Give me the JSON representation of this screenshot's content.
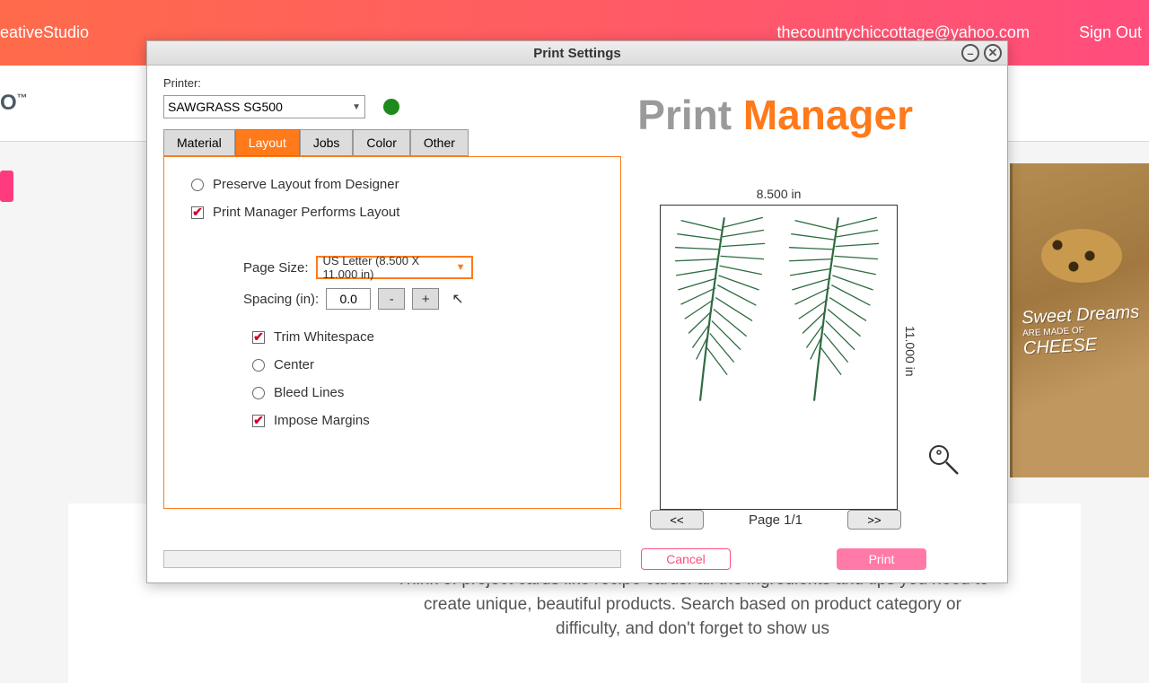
{
  "topbar": {
    "left": "eativeStudio",
    "email": "thecountrychiccottage@yahoo.com",
    "signout": "Sign Out"
  },
  "header2": {
    "logo_fragment": "O",
    "tm": "™"
  },
  "background": {
    "board_text_line1": "Sweet Dreams",
    "board_text_line2": "ARE MADE OF",
    "board_text_line3": "CHEESE",
    "description": "Think of project cards like recipe cards: all the ingredients and tips you need to create unique, beautiful products. Search based on product category or difficulty, and don't forget to show us"
  },
  "dialog": {
    "title": "Print Settings",
    "printer_label": "Printer:",
    "printer_value": "SAWGRASS SG500",
    "tabs": [
      "Material",
      "Layout",
      "Jobs",
      "Color",
      "Other"
    ],
    "active_tab": "Layout",
    "layout": {
      "radio_preserve": "Preserve Layout from Designer",
      "radio_pm": "Print Manager Performs Layout",
      "page_size_label": "Page Size:",
      "page_size_value": "US Letter (8.500 X 11.000 in)",
      "spacing_label": "Spacing (in):",
      "spacing_value": "0.0",
      "minus": "-",
      "plus": "+",
      "trim": "Trim Whitespace",
      "center": "Center",
      "bleed": "Bleed Lines",
      "margins": "Impose Margins"
    },
    "brand_a": "Print ",
    "brand_b": "Manager",
    "preview": {
      "width_label": "8.500 in",
      "height_label": "11.000 in",
      "prev_btn": "<<",
      "next_btn": ">>",
      "page_label": "Page 1/1"
    },
    "cancel": "Cancel",
    "print": "Print"
  }
}
